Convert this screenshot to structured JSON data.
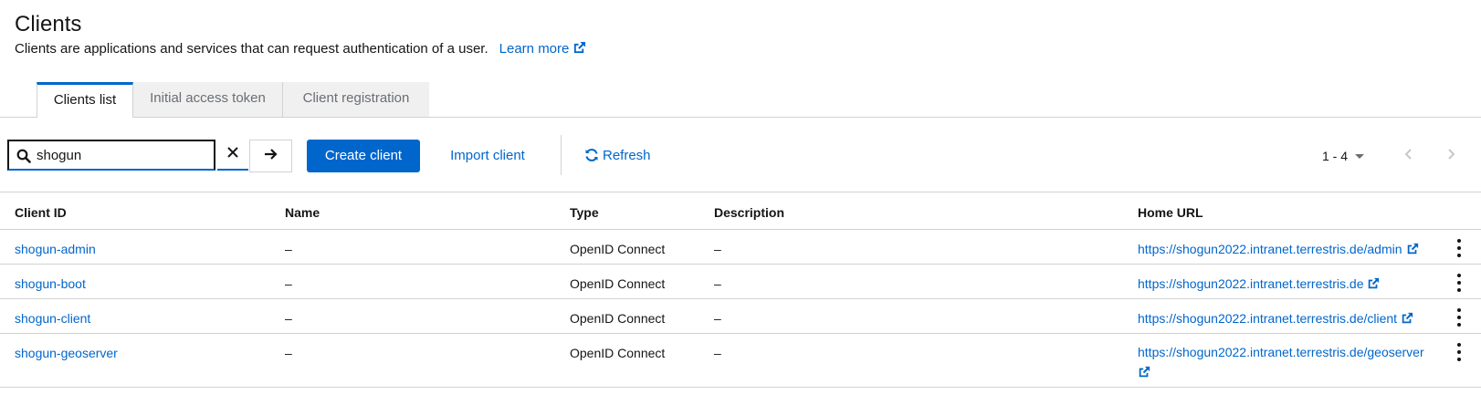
{
  "page": {
    "title": "Clients",
    "description": "Clients are applications and services that can request authentication of a user.",
    "learn_more": "Learn more"
  },
  "tabs": [
    {
      "label": "Clients list",
      "active": true
    },
    {
      "label": "Initial access token",
      "active": false
    },
    {
      "label": "Client registration",
      "active": false
    }
  ],
  "toolbar": {
    "search_value": "shogun",
    "create_label": "Create client",
    "import_label": "Import client",
    "refresh_label": "Refresh",
    "pagination": "1 - 4"
  },
  "table": {
    "headers": [
      "Client ID",
      "Name",
      "Type",
      "Description",
      "Home URL"
    ],
    "rows": [
      {
        "client_id": "shogun-admin",
        "name": "–",
        "type": "OpenID Connect",
        "description": "–",
        "home_url": "https://shogun2022.intranet.terrestris.de/admin"
      },
      {
        "client_id": "shogun-boot",
        "name": "–",
        "type": "OpenID Connect",
        "description": "–",
        "home_url": "https://shogun2022.intranet.terrestris.de"
      },
      {
        "client_id": "shogun-client",
        "name": "–",
        "type": "OpenID Connect",
        "description": "–",
        "home_url": "https://shogun2022.intranet.terrestris.de/client"
      },
      {
        "client_id": "shogun-geoserver",
        "name": "–",
        "type": "OpenID Connect",
        "description": "–",
        "home_url": "https://shogun2022.intranet.terrestris.de/geoserver"
      }
    ]
  },
  "colors": {
    "link": "#0066cc",
    "primary_button": "#0066cc",
    "border": "#d2d2d2"
  }
}
